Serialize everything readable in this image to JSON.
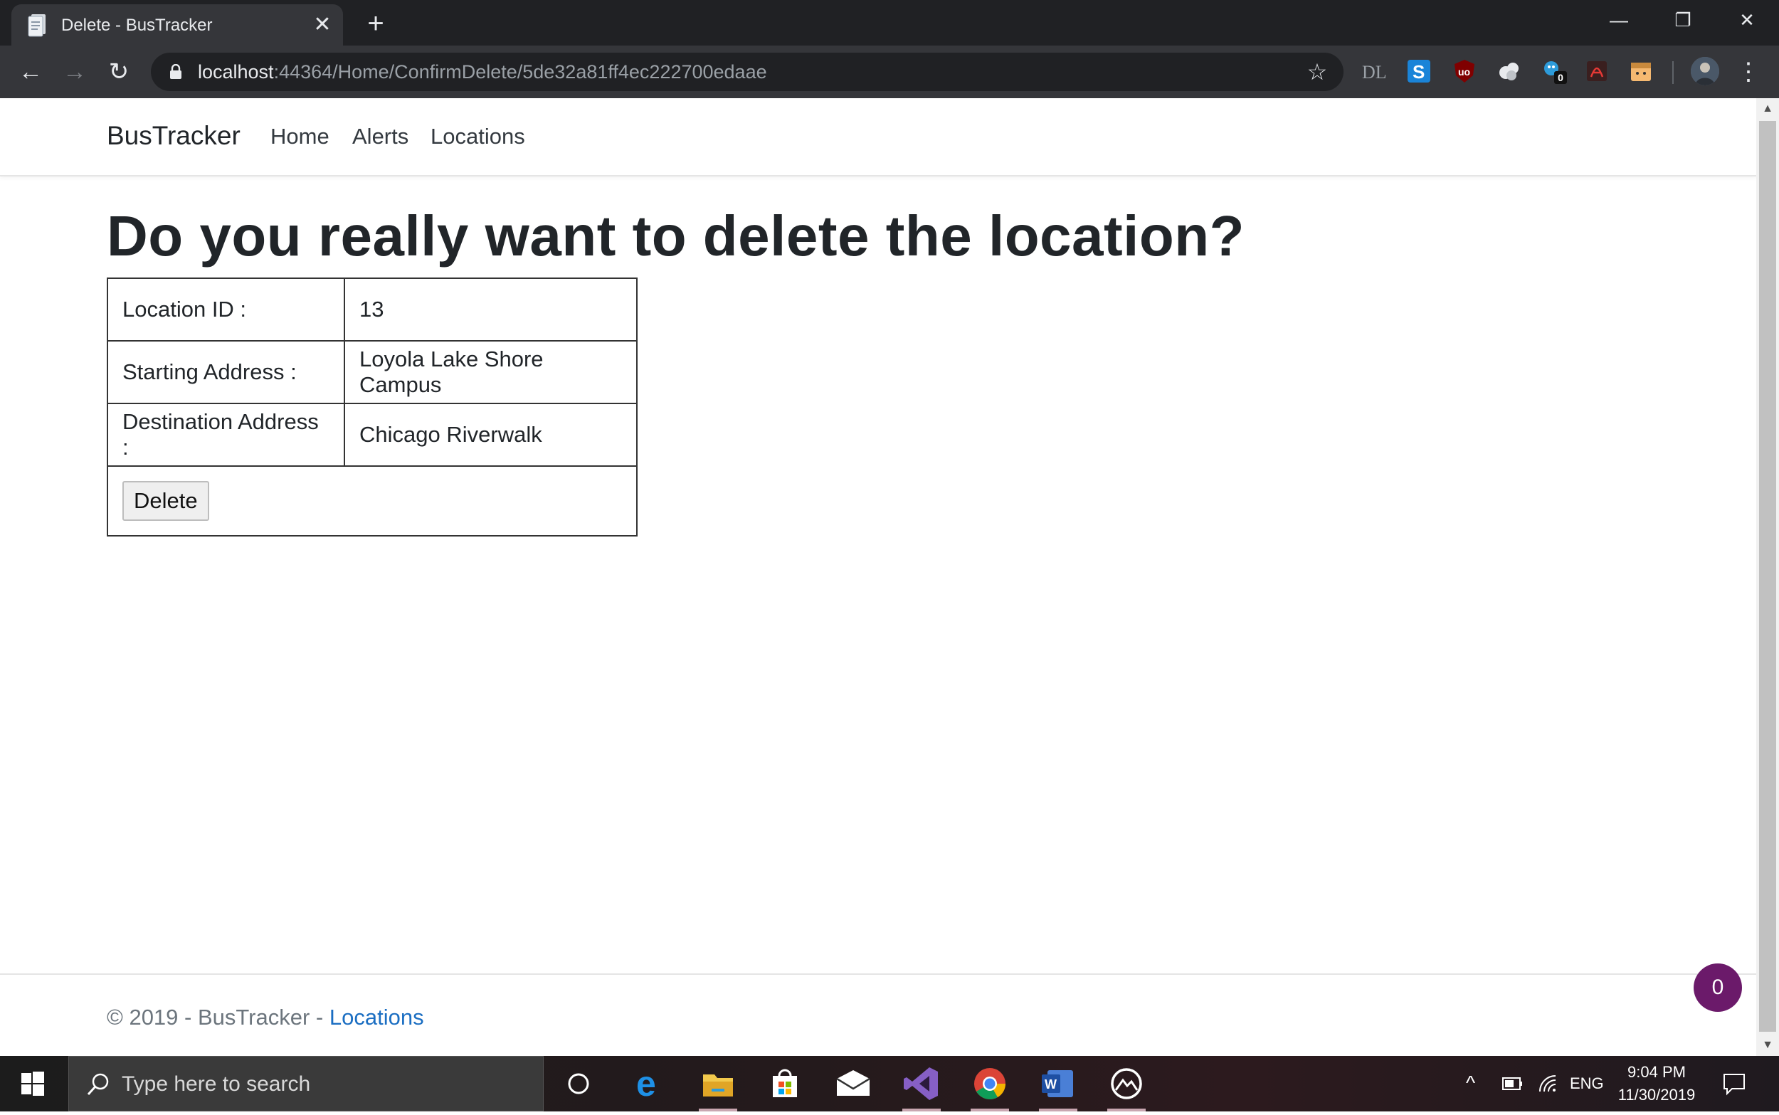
{
  "browser": {
    "tab_title": "Delete - BusTracker",
    "url_host": "localhost",
    "url_rest": ":44364/Home/ConfirmDelete/5de32a81ff4ec222700edaae",
    "extension_badge": "0"
  },
  "site": {
    "brand": "BusTracker",
    "nav": [
      "Home",
      "Alerts",
      "Locations"
    ]
  },
  "page": {
    "heading": "Do you really want to delete the location?",
    "rows": [
      {
        "label": "Location ID :",
        "value": "13"
      },
      {
        "label": "Starting Address :",
        "value": "Loyola Lake Shore Campus"
      },
      {
        "label": "Destination Address :",
        "value": "Chicago Riverwalk"
      }
    ],
    "delete_label": "Delete"
  },
  "footer": {
    "text": "© 2019 - BusTracker - ",
    "link": "Locations"
  },
  "notification_count": "0",
  "taskbar": {
    "search_placeholder": "Type here to search",
    "language": "ENG",
    "time": "9:04 PM",
    "date": "11/30/2019"
  }
}
